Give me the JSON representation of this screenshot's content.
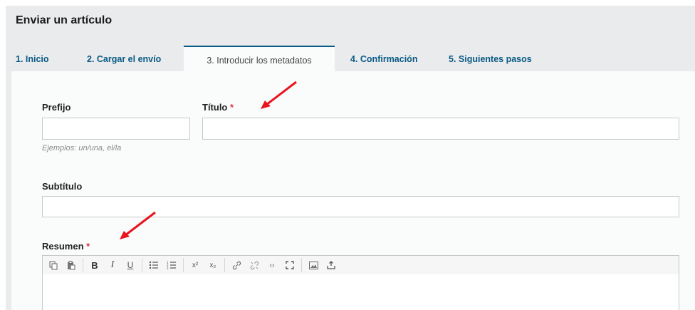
{
  "page": {
    "title": "Enviar un artículo"
  },
  "tabs": [
    {
      "label": "1. Inicio",
      "active": false
    },
    {
      "label": "2. Cargar el envío",
      "active": false
    },
    {
      "label": "3. Introducir los metadatos",
      "active": true
    },
    {
      "label": "4. Confirmación",
      "active": false
    },
    {
      "label": "5. Siguientes pasos",
      "active": false
    }
  ],
  "form": {
    "prefix": {
      "label": "Prefijo",
      "value": "",
      "hint": "Ejemplos: un/una, el/la"
    },
    "title": {
      "label": "Título",
      "required_mark": "*",
      "value": ""
    },
    "subtitle": {
      "label": "Subtítulo",
      "value": ""
    },
    "abstract": {
      "label": "Resumen",
      "required_mark": "*",
      "value": ""
    }
  },
  "editor_toolbar": [
    {
      "name": "copy-icon",
      "glyph": "⎘"
    },
    {
      "name": "paste-icon",
      "glyph": "📋"
    },
    {
      "name": "bold-icon",
      "glyph": "B"
    },
    {
      "name": "italic-icon",
      "glyph": "I"
    },
    {
      "name": "underline-icon",
      "glyph": "U"
    },
    {
      "name": "bullet-list-icon",
      "glyph": "☰"
    },
    {
      "name": "numbered-list-icon",
      "glyph": "☷"
    },
    {
      "name": "superscript-icon",
      "glyph": "x²"
    },
    {
      "name": "subscript-icon",
      "glyph": "x₂"
    },
    {
      "name": "link-icon",
      "glyph": "🔗"
    },
    {
      "name": "unlink-icon",
      "glyph": "⛓"
    },
    {
      "name": "code-icon",
      "glyph": "‹›"
    },
    {
      "name": "fullscreen-icon",
      "glyph": "⤢"
    },
    {
      "name": "image-icon",
      "glyph": "▣"
    },
    {
      "name": "upload-icon",
      "glyph": "⤓"
    }
  ],
  "colors": {
    "accent": "#0a5a86",
    "required": "#d9394a",
    "annotation_arrow": "#e8141e",
    "background": "#e9ebec"
  }
}
